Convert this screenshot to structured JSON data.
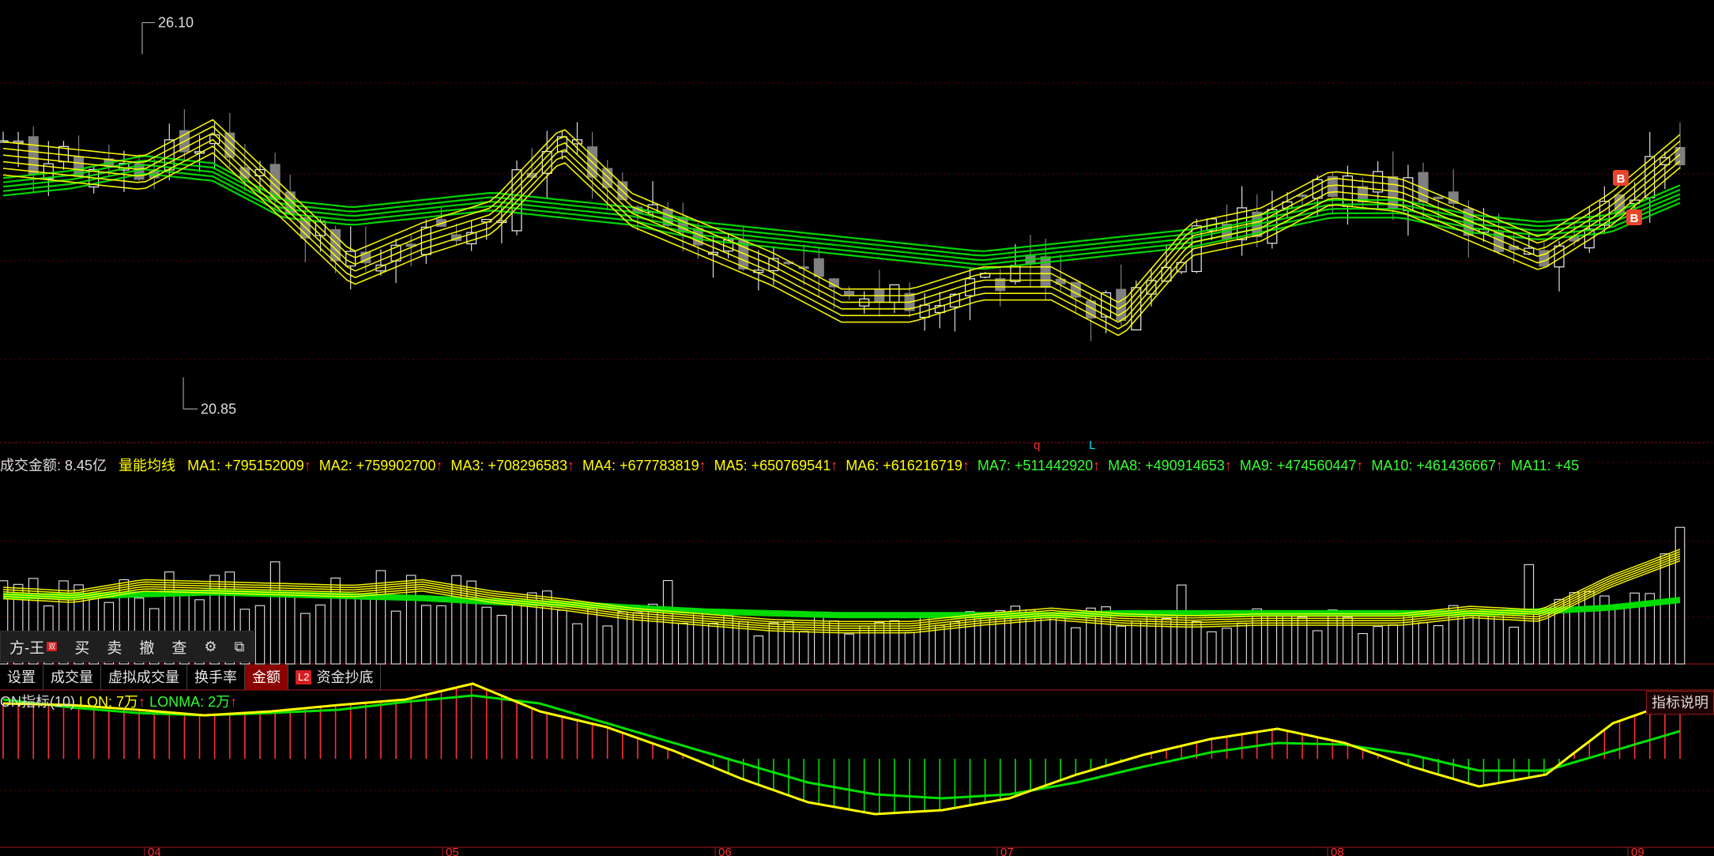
{
  "colors": {
    "up_candle": "#ffffff",
    "down_candle": "#808080",
    "yellow": "#ffff00",
    "green": "#00e000",
    "red": "#ff3030",
    "grid": "#6a0000",
    "label": "#cccccc"
  },
  "price_panel": {
    "high_label": "26.10",
    "low_label": "20.85",
    "marker_q": "q",
    "marker_l": "L",
    "signal_1": "B",
    "signal_2": "B"
  },
  "ma_bar": {
    "amount_label": "成交金额: 8.45亿",
    "indicator_name": "量能均线",
    "items": [
      {
        "label": "MA1: +795152009",
        "arrow": "↑",
        "color": "#ffff00"
      },
      {
        "label": "MA2: +759902700",
        "arrow": "↑",
        "color": "#ffff00"
      },
      {
        "label": "MA3: +708296583",
        "arrow": "↑",
        "color": "#ffff00"
      },
      {
        "label": "MA4: +677783819",
        "arrow": "↑",
        "color": "#ffff00"
      },
      {
        "label": "MA5: +650769541",
        "arrow": "↑",
        "color": "#ffff00"
      },
      {
        "label": "MA6: +616216719",
        "arrow": "↑",
        "color": "#ffff00"
      },
      {
        "label": "MA7: +511442920",
        "arrow": "↑",
        "color": "#33ff33"
      },
      {
        "label": "MA8: +490914653",
        "arrow": "↑",
        "color": "#33ff33"
      },
      {
        "label": "MA9: +474560447",
        "arrow": "↑",
        "color": "#33ff33"
      },
      {
        "label": "MA10: +461436667",
        "arrow": "↑",
        "color": "#33ff33"
      },
      {
        "label": "MA11: +45",
        "arrow": "",
        "color": "#33ff33"
      }
    ]
  },
  "toolbar": {
    "name": "方-王",
    "name_badge": "双",
    "buy": "买",
    "sell": "卖",
    "cancel": "撤",
    "query": "查",
    "settings_icon": "gear-icon",
    "window_icon": "window-icon"
  },
  "tabs": [
    {
      "label": "设置",
      "active": false
    },
    {
      "label": "成交量",
      "active": false
    },
    {
      "label": "虚拟成交量",
      "active": false
    },
    {
      "label": "换手率",
      "active": false
    },
    {
      "label": "金额",
      "active": true
    },
    {
      "label": "资金抄底",
      "active": false,
      "badge": "L2"
    }
  ],
  "lon_bar": {
    "title": "ON指标(10)",
    "lon_label": "LON: 7万",
    "lonma_label": "LONMA: 2万",
    "arrow": "↑",
    "explain_button": "指标说明"
  },
  "chart_data": [
    {
      "type": "candlestick",
      "title": "",
      "ylim": [
        20.5,
        26.3
      ],
      "annotations": [
        {
          "label": "26.10",
          "value": 26.1
        },
        {
          "label": "20.85",
          "value": 20.85
        }
      ],
      "x_tick_labels": [
        "04",
        "05",
        "06",
        "07",
        "08",
        "09"
      ],
      "series": [
        {
          "name": "short MAs",
          "color": "yellow",
          "count": 6,
          "values": [
            24.3,
            24.2,
            24.1,
            24.6,
            23.7,
            22.8,
            23.2,
            23.5,
            24.5,
            23.6,
            23.2,
            22.8,
            22.3,
            22.3,
            22.6,
            22.6,
            22.1,
            23.2,
            23.4,
            23.9,
            23.8,
            23.4,
            23.0,
            23.6,
            24.4
          ]
        },
        {
          "name": "long MAs",
          "color": "green",
          "count": 5,
          "values": [
            23.9,
            24.0,
            24.2,
            24.1,
            23.6,
            23.5,
            23.6,
            23.7,
            23.6,
            23.5,
            23.3,
            23.2,
            23.1,
            23.0,
            22.9,
            23.0,
            23.1,
            23.2,
            23.4,
            23.6,
            23.6,
            23.4,
            23.3,
            23.4,
            23.8
          ]
        }
      ]
    },
    {
      "type": "bar",
      "title": "",
      "ylim": [
        0,
        1
      ],
      "series": [
        {
          "name": "MA1–MA6",
          "color": "yellow",
          "values": [
            0.38,
            0.36,
            0.42,
            0.41,
            0.4,
            0.39,
            0.42,
            0.36,
            0.32,
            0.27,
            0.24,
            0.21,
            0.2,
            0.2,
            0.24,
            0.27,
            0.24,
            0.23,
            0.24,
            0.24,
            0.24,
            0.28,
            0.26,
            0.44,
            0.58
          ]
        },
        {
          "name": "MA7–MA11",
          "color": "green",
          "values": [
            0.36,
            0.36,
            0.37,
            0.38,
            0.37,
            0.36,
            0.35,
            0.33,
            0.32,
            0.3,
            0.28,
            0.27,
            0.26,
            0.26,
            0.26,
            0.26,
            0.27,
            0.27,
            0.27,
            0.27,
            0.27,
            0.27,
            0.28,
            0.3,
            0.34
          ]
        }
      ]
    },
    {
      "type": "bar",
      "title": "",
      "ylim": [
        -1,
        1
      ],
      "series": [
        {
          "name": "LON",
          "color": "yellow",
          "values": [
            0.7,
            0.68,
            0.62,
            0.55,
            0.6,
            0.68,
            0.75,
            0.95,
            0.6,
            0.4,
            0.1,
            -0.25,
            -0.55,
            -0.7,
            -0.65,
            -0.5,
            -0.2,
            0.05,
            0.25,
            0.38,
            0.2,
            -0.1,
            -0.35,
            -0.2,
            0.45,
            0.75
          ]
        },
        {
          "name": "LONMA",
          "color": "green",
          "values": [
            0.75,
            0.65,
            0.58,
            0.55,
            0.58,
            0.62,
            0.72,
            0.8,
            0.7,
            0.45,
            0.2,
            -0.05,
            -0.3,
            -0.45,
            -0.5,
            -0.45,
            -0.3,
            -0.1,
            0.08,
            0.2,
            0.18,
            0.05,
            -0.15,
            -0.15,
            0.1,
            0.35
          ]
        }
      ]
    }
  ]
}
